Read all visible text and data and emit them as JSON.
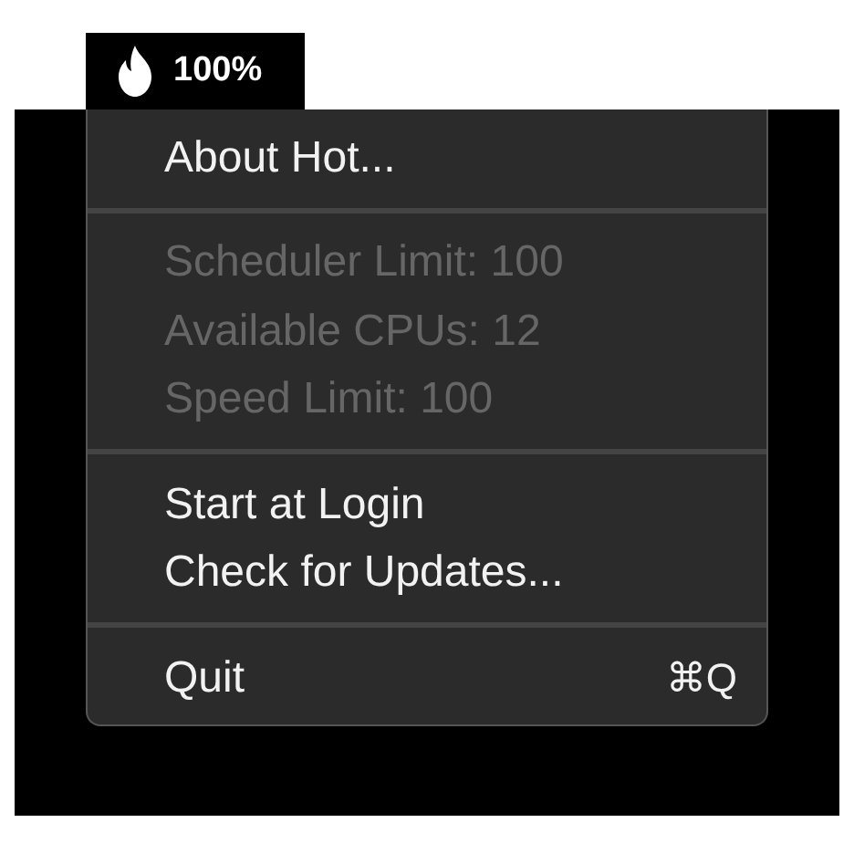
{
  "menu_bar_item": {
    "label": "100%"
  },
  "menu": {
    "groups": [
      {
        "items": [
          {
            "label": "About Hot...",
            "disabled": false
          }
        ]
      },
      {
        "items": [
          {
            "label": "Scheduler Limit: 100",
            "disabled": true
          },
          {
            "label": "Available CPUs: 12",
            "disabled": true
          },
          {
            "label": "Speed Limit: 100",
            "disabled": true
          }
        ]
      },
      {
        "items": [
          {
            "label": "Start at Login",
            "disabled": false
          },
          {
            "label": "Check for Updates...",
            "disabled": false
          }
        ]
      },
      {
        "items": [
          {
            "label": "Quit",
            "disabled": false,
            "shortcut": "⌘Q"
          }
        ]
      }
    ]
  }
}
